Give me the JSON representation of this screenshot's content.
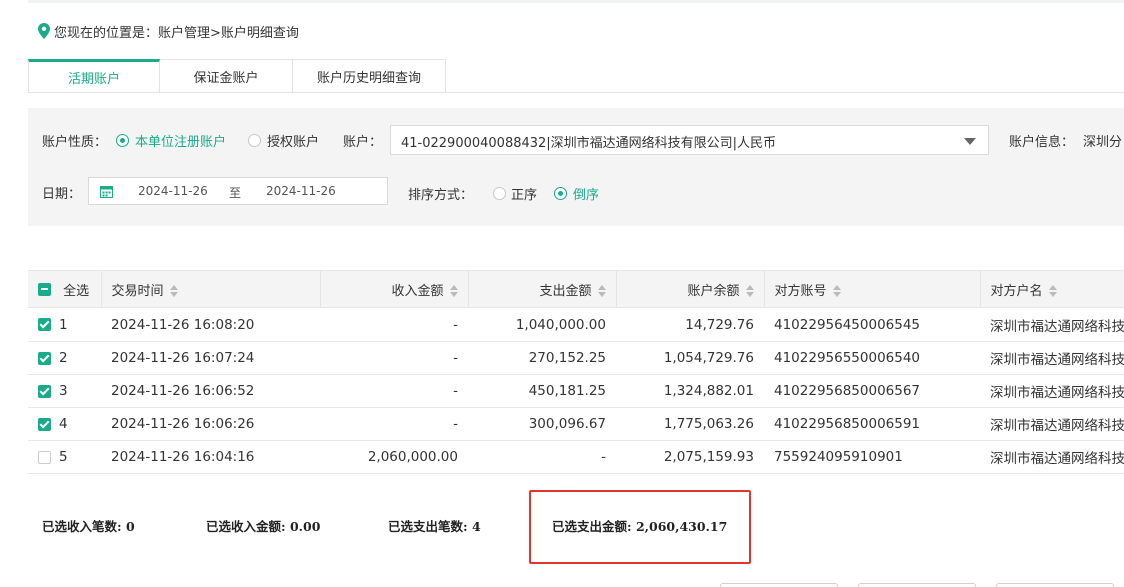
{
  "breadcrumb": {
    "text": "您现在的位置是：账户管理>账户明细查询"
  },
  "tabs": [
    {
      "label": "活期账户",
      "active": true
    },
    {
      "label": "保证金账户",
      "active": false
    },
    {
      "label": "账户历史明细查询",
      "active": false
    }
  ],
  "filters": {
    "nature_label": "账户性质：",
    "nature_options": [
      {
        "label": "本单位注册账户",
        "selected": true
      },
      {
        "label": "授权账户",
        "selected": false
      }
    ],
    "account_label": "账户：",
    "account_value": "41-022900040088432|深圳市福达通网络科技有限公司|人民币",
    "info_label": "账户信息：",
    "info_value": "深圳分",
    "date_label": "日期：",
    "date_from": "2024-11-26",
    "date_sep": "至",
    "date_to": "2024-11-26",
    "sort_label": "排序方式：",
    "sort_options": [
      {
        "label": "正序",
        "selected": false
      },
      {
        "label": "倒序",
        "selected": true
      }
    ]
  },
  "table": {
    "select_all": "全选",
    "headers": [
      "交易时间",
      "收入金额",
      "支出金额",
      "账户余额",
      "对方账号",
      "对方户名"
    ],
    "rows": [
      {
        "checked": true,
        "index": "1",
        "time": "2024-11-26 16:08:20",
        "income": "-",
        "expense": "1,040,000.00",
        "balance": "14,729.76",
        "account": "41022956450006545",
        "name": "深圳市福达通网络科技"
      },
      {
        "checked": true,
        "index": "2",
        "time": "2024-11-26 16:07:24",
        "income": "-",
        "expense": "270,152.25",
        "balance": "1,054,729.76",
        "account": "41022956550006540",
        "name": "深圳市福达通网络科技"
      },
      {
        "checked": true,
        "index": "3",
        "time": "2024-11-26 16:06:52",
        "income": "-",
        "expense": "450,181.25",
        "balance": "1,324,882.01",
        "account": "41022956850006567",
        "name": "深圳市福达通网络科技"
      },
      {
        "checked": true,
        "index": "4",
        "time": "2024-11-26 16:06:26",
        "income": "-",
        "expense": "300,096.67",
        "balance": "1,775,063.26",
        "account": "41022956850006591",
        "name": "深圳市福达通网络科技"
      },
      {
        "checked": false,
        "index": "5",
        "time": "2024-11-26 16:04:16",
        "income": "2,060,000.00",
        "expense": "-",
        "balance": "2,075,159.93",
        "account": "755924095910901",
        "name": "深圳市福达通网络科技"
      }
    ]
  },
  "summary": {
    "income_count": "已选收入笔数: 0",
    "income_amount": "已选收入金额: 0.00",
    "expense_count": "已选支出笔数: 4",
    "expense_amount": "已选支出金额: 2,060,430.17"
  },
  "colors": {
    "accent": "#1aab8b",
    "highlight": "#e4352c"
  }
}
